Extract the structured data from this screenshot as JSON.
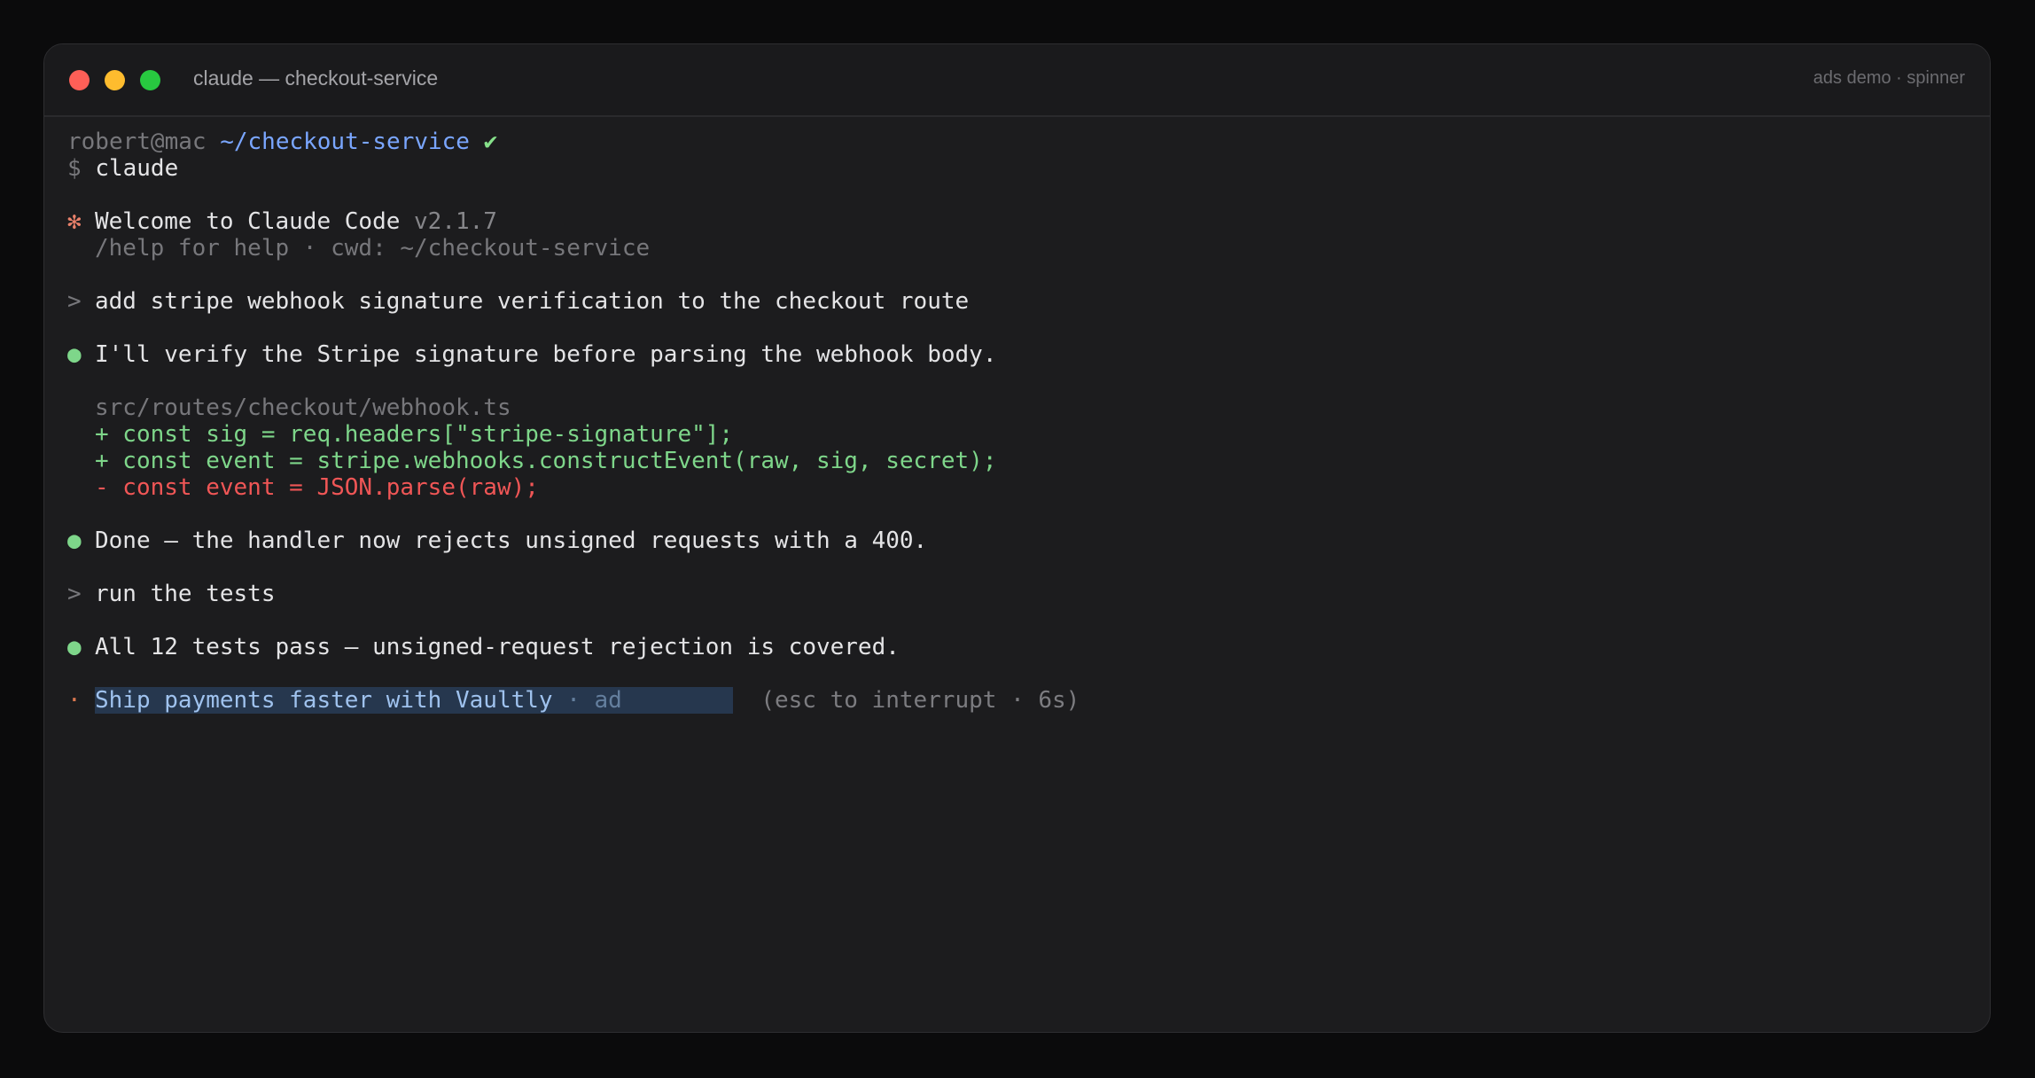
{
  "window": {
    "title": "claude — checkout-service",
    "tag": "ads demo · spinner"
  },
  "prompt": {
    "user_host": "robert@mac",
    "cwd": "~/checkout-service",
    "check": "✔",
    "dollar": "$",
    "command": "claude"
  },
  "welcome": {
    "icon": "✻",
    "title": "Welcome to Claude Code",
    "version": "v2.1.7",
    "help": "/help for help · cwd: ~/checkout-service"
  },
  "conversation": {
    "user_marker": ">",
    "bullet": "●",
    "user1": "add stripe webhook signature verification to the checkout route",
    "reply1": "I'll verify the Stripe signature before parsing the webhook body.",
    "diff_file": "src/routes/checkout/webhook.ts",
    "diff_lines": [
      "+ const sig = req.headers[\"stripe-signature\"];",
      "+ const event = stripe.webhooks.constructEvent(raw, sig, secret);",
      "- const event = JSON.parse(raw);"
    ],
    "reply2": "Done — the handler now rejects unsigned requests with a 400.",
    "user2": "run the tests",
    "reply3": "All 12 tests pass — unsigned-request rejection is covered."
  },
  "spinner": {
    "glyph": "·",
    "ad_text": "Ship payments faster with Vaultly",
    "ad_sep": " · ",
    "ad_label": "ad",
    "hint": "(esc to interrupt · 6s)"
  },
  "colors": {
    "background": "#0b0b0c",
    "window": "#1c1c1e",
    "path": "#7aa6ff",
    "add": "#7ed68a",
    "delete": "#f05656",
    "accent": "#e8806a",
    "ad_highlight": "#26374e"
  }
}
